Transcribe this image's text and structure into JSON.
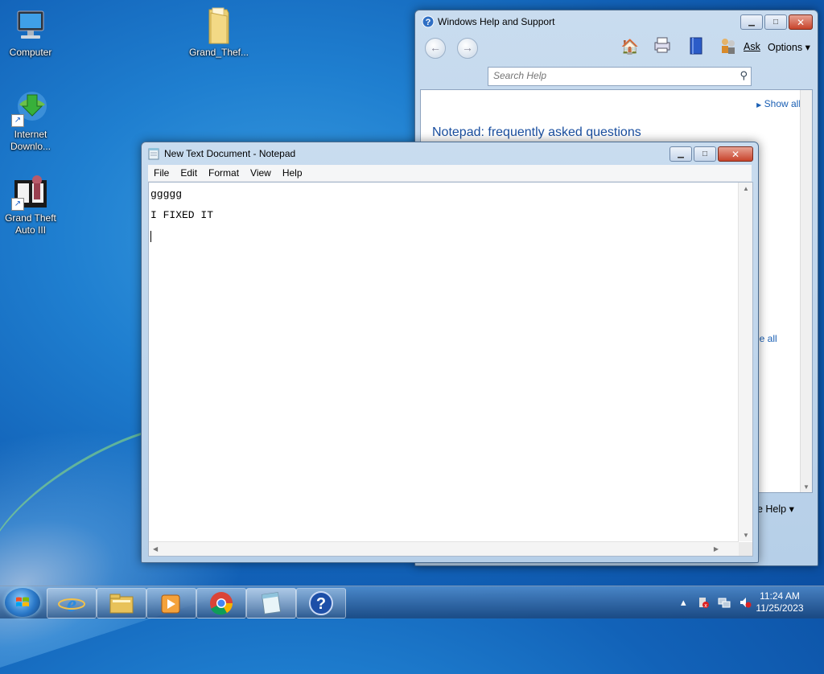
{
  "desktop": {
    "icons": [
      {
        "label": "Computer"
      },
      {
        "label": "Grand_Thef..."
      },
      {
        "label": "Internet Downlo..."
      },
      {
        "label": "Grand Theft Auto III"
      }
    ]
  },
  "help_window": {
    "title": "Windows Help and Support",
    "ask_label": "Ask",
    "options_label": "Options",
    "search_placeholder": "Search Help",
    "show_all": "Show all",
    "faq_title": "Notepad: frequently asked questions",
    "see_all_partial": "ee all",
    "footer_partial": "ge Help"
  },
  "notepad": {
    "title": "New Text Document - Notepad",
    "menu": [
      "File",
      "Edit",
      "Format",
      "View",
      "Help"
    ],
    "lines": [
      "ggggg",
      "I FIXED IT",
      ""
    ]
  },
  "taskbar": {
    "time": "11:24 AM",
    "date": "11/25/2023",
    "apps": [
      "internet-explorer",
      "file-explorer",
      "media-player",
      "chrome",
      "notepad",
      "help-and-support"
    ]
  },
  "colors": {
    "accent_link": "#1a5fb4",
    "close_red": "#c7432b"
  }
}
